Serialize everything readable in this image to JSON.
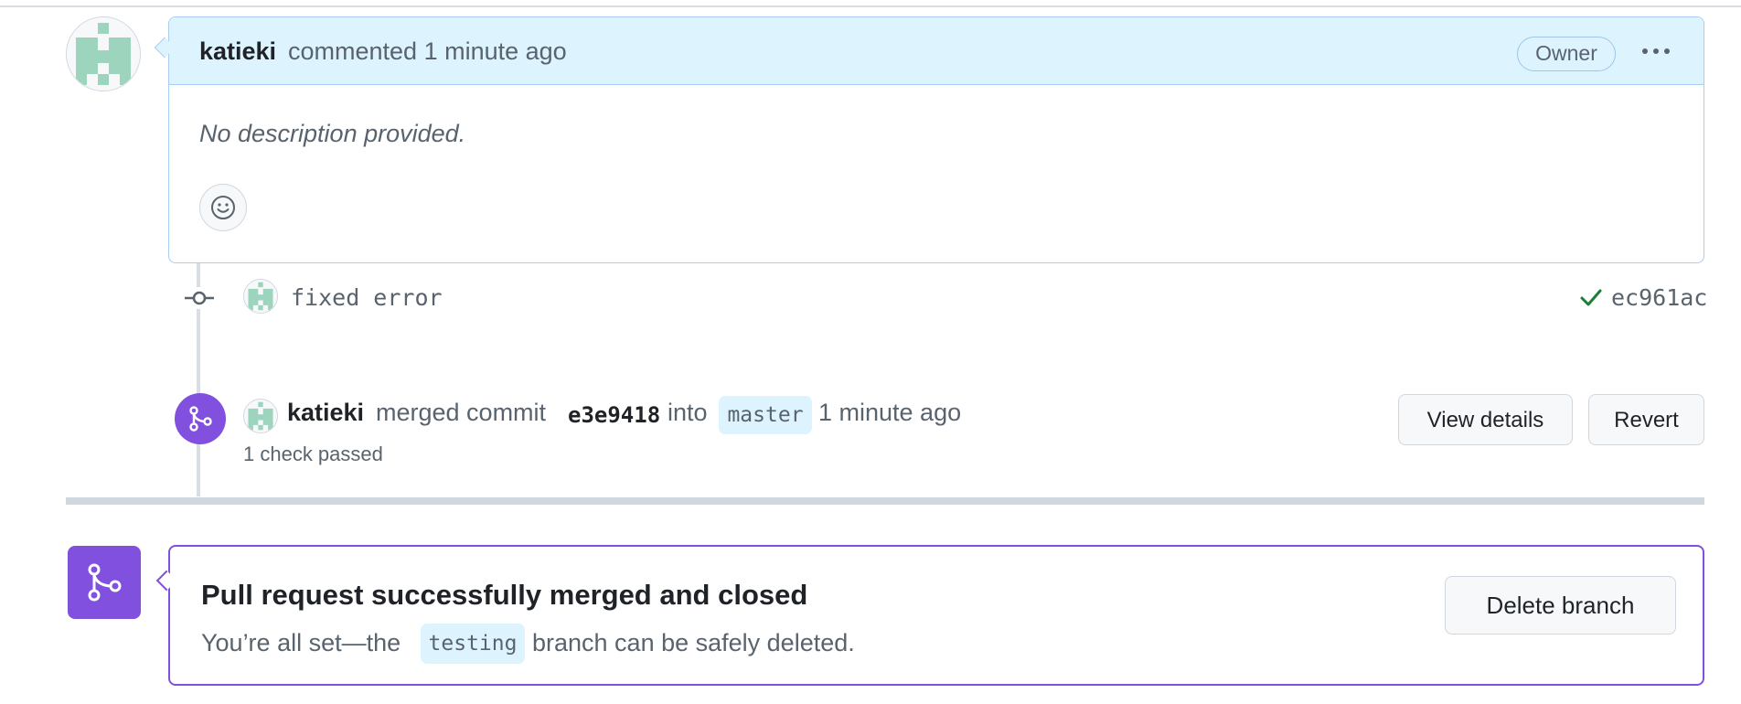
{
  "comment": {
    "author": "katieki",
    "action": "commented 1 minute ago",
    "badge": "Owner",
    "body": "No description provided.",
    "icons": {
      "avatar": "identicon-avatar",
      "menu": "kebab-horizontal-icon",
      "reaction": "smiley-icon"
    }
  },
  "commit": {
    "message": "fixed error",
    "sha": "ec961ac",
    "status": "success",
    "icons": {
      "node": "git-commit-icon",
      "status": "check-icon"
    }
  },
  "merge_event": {
    "author": "katieki",
    "text_before_sha": "merged commit",
    "sha": "e3e9418",
    "text_into": "into",
    "branch": "master",
    "time": "1 minute ago",
    "checks": "1 check passed",
    "view_details_label": "View details",
    "revert_label": "Revert"
  },
  "merged_box": {
    "title": "Pull request successfully merged and closed",
    "desc_before": "You’re all set—the",
    "branch": "testing",
    "desc_after": "branch can be safely deleted.",
    "delete_branch_label": "Delete branch"
  },
  "colors": {
    "merged_purple": "#8250df",
    "comment_header_bg": "#ddf4ff",
    "comment_border": "#a9cdf0",
    "success_green": "#1a7f37",
    "identicon_green": "#9dd4bd"
  }
}
